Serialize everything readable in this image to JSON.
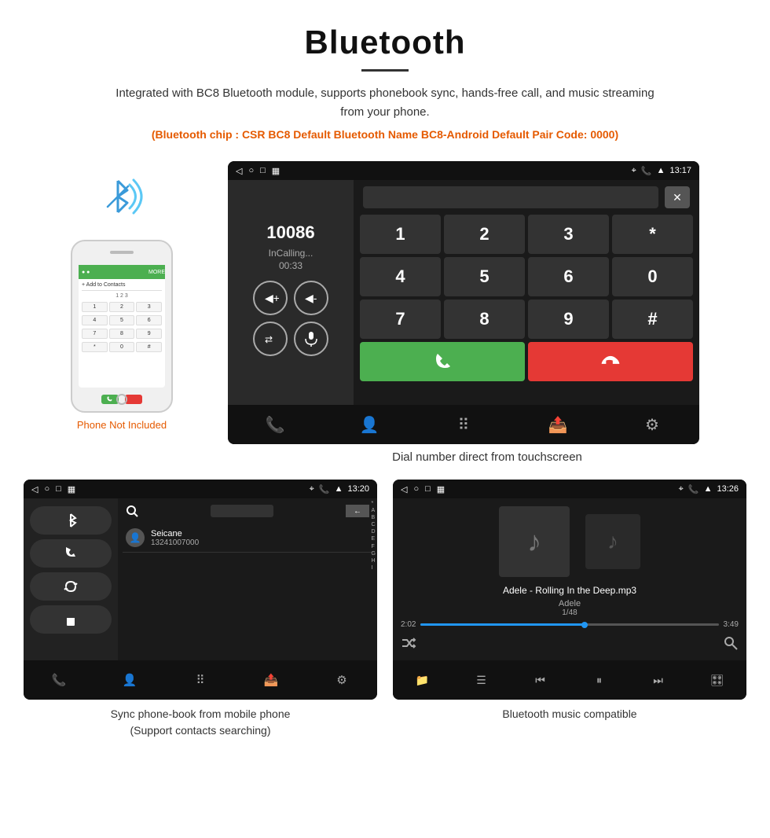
{
  "page": {
    "title": "Bluetooth",
    "title_divider": true,
    "description": "Integrated with BC8 Bluetooth module, supports phonebook sync, hands-free call, and music streaming from your phone.",
    "bluetooth_info": "(Bluetooth chip : CSR BC8    Default Bluetooth Name BC8-Android    Default Pair Code: 0000)"
  },
  "dial_screen": {
    "status_bar": {
      "left_icons": [
        "back-arrow",
        "circle",
        "square",
        "screenshot"
      ],
      "right_icons": [
        "location-icon",
        "call-icon",
        "wifi-icon",
        "battery-icon"
      ],
      "time": "13:17"
    },
    "phone_number": "10086",
    "call_status": "InCalling...",
    "call_timer": "00:33",
    "keypad": {
      "keys": [
        "1",
        "2",
        "3",
        "*",
        "4",
        "5",
        "6",
        "0",
        "7",
        "8",
        "9",
        "#"
      ]
    },
    "caption": "Dial number direct from touchscreen"
  },
  "phonebook_screen": {
    "status_bar": {
      "right_icons": [
        "location-icon",
        "call-icon",
        "wifi-icon",
        "battery-icon"
      ],
      "time": "13:20"
    },
    "contact": {
      "name": "Seicane",
      "number": "13241007000"
    },
    "alphabet": [
      "*",
      "A",
      "B",
      "C",
      "D",
      "E",
      "F",
      "G",
      "H",
      "I"
    ],
    "caption_line1": "Sync phone-book from mobile phone",
    "caption_line2": "(Support contacts searching)"
  },
  "music_screen": {
    "status_bar": {
      "time": "13:26"
    },
    "track_name": "Adele - Rolling In the Deep.mp3",
    "artist": "Adele",
    "counter": "1/48",
    "time_current": "2:02",
    "time_total": "3:49",
    "progress_percent": 55,
    "caption": "Bluetooth music compatible"
  },
  "phone_widget": {
    "not_included": "Phone Not Included"
  }
}
